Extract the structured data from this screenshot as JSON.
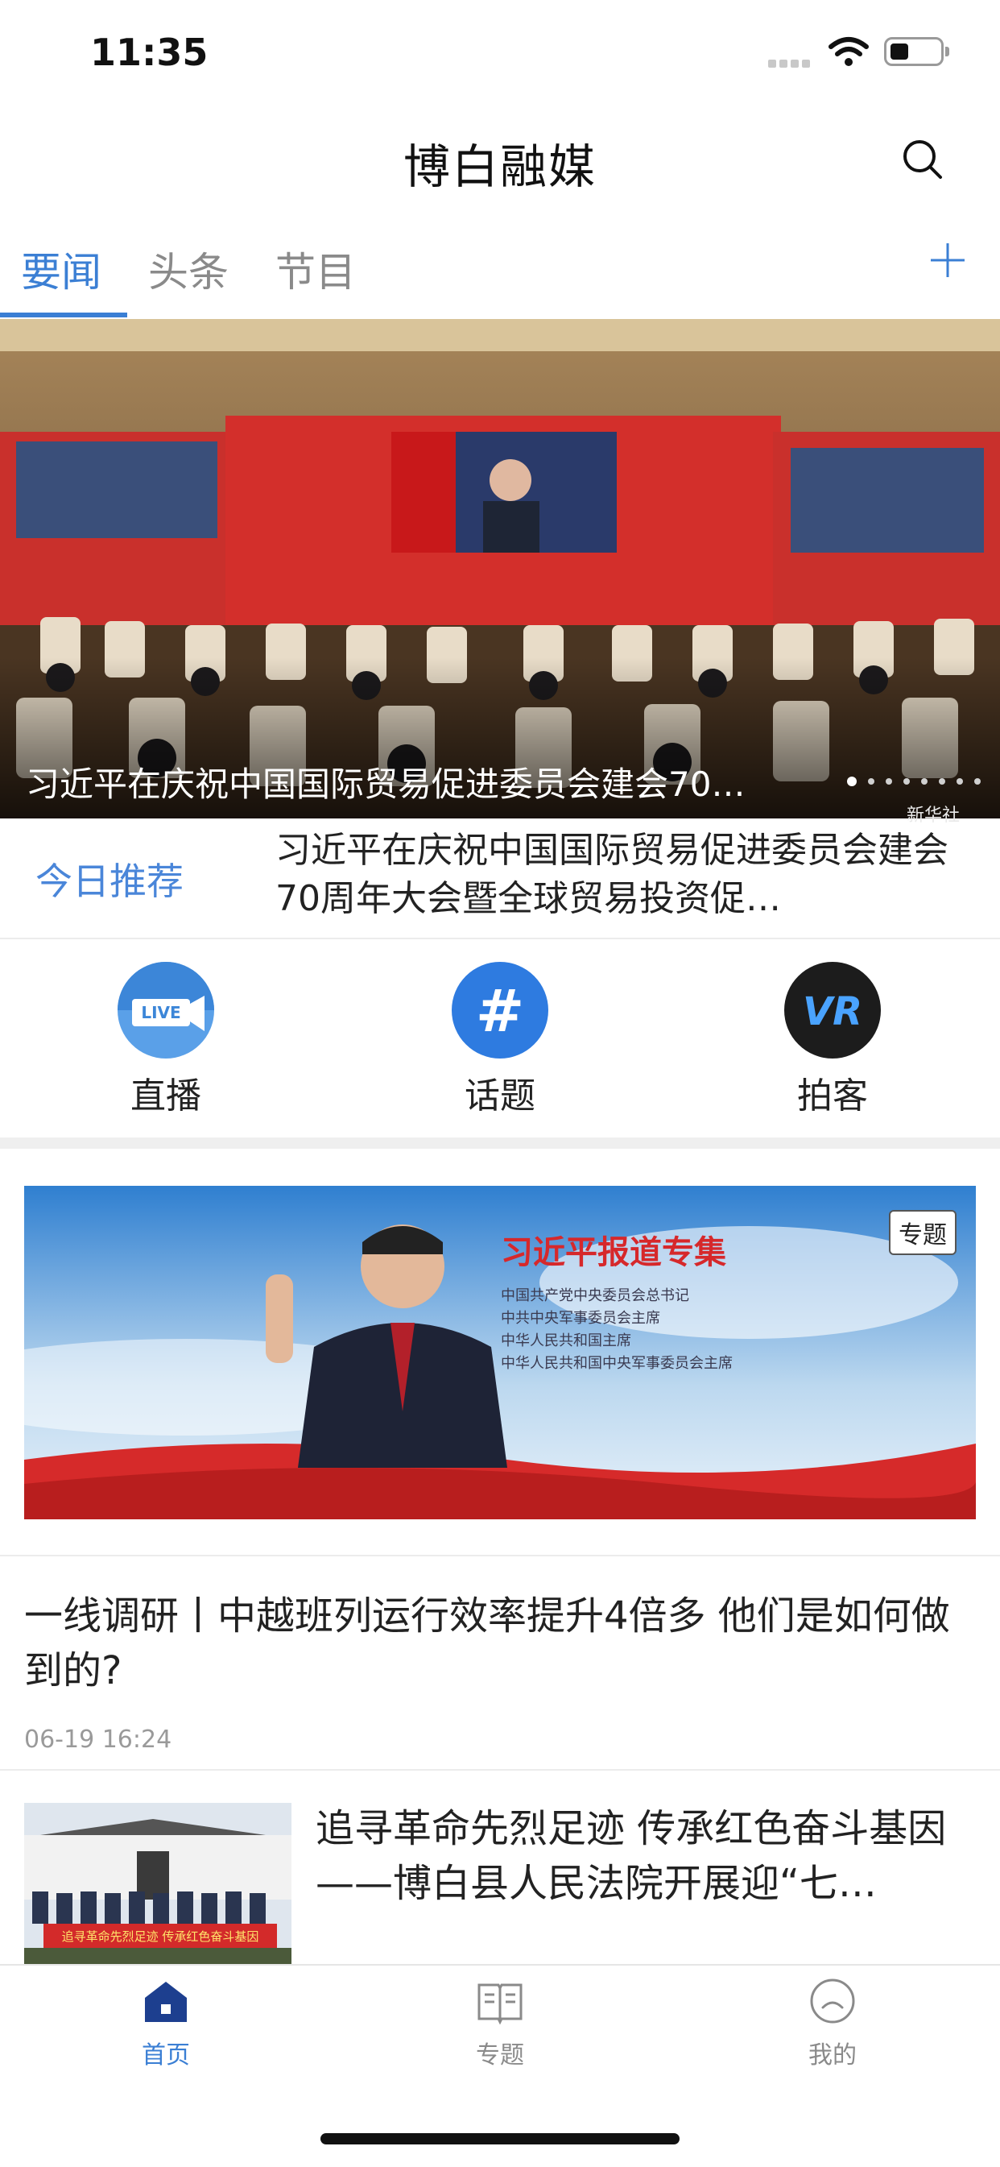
{
  "status_bar": {
    "time": "11:35"
  },
  "header": {
    "title": "博白融媒"
  },
  "tabs": [
    {
      "label": "要闻",
      "active": true
    },
    {
      "label": "头条",
      "active": false
    },
    {
      "label": "节目",
      "active": false
    }
  ],
  "hero": {
    "caption": "习近平在庆祝中国国际贸易促进委员会建会70…",
    "watermark": "新华社",
    "slide_count": 8,
    "active_slide": 1
  },
  "today_pick": {
    "label": "今日推荐",
    "text": "习近平在庆祝中国国际贸易促进委员会建会70周年大会暨全球贸易投资促…"
  },
  "quick_entries": [
    {
      "label": "直播",
      "icon": "live-icon",
      "badge": "LIVE"
    },
    {
      "label": "话题",
      "icon": "hashtag-icon",
      "badge": "#"
    },
    {
      "label": "拍客",
      "icon": "vr-icon",
      "badge": "VR"
    }
  ],
  "banner": {
    "title": "习近平报道专集",
    "lines": [
      "中国共产党中央委员会总书记",
      "中共中央军事委员会主席",
      "中华人民共和国主席",
      "中华人民共和国中央军事委员会主席"
    ],
    "badge": "专题"
  },
  "articles": [
    {
      "title": "一线调研丨中越班列运行效率提升4倍多 他们是如何做到的?",
      "time": "06-19 16:24"
    },
    {
      "title": "追寻革命先烈足迹 传承红色奋斗基因——博白县人民法院开展迎“七…",
      "thumb_text": "追寻革命先烈足迹 传承红色奋斗基因"
    }
  ],
  "bottom_nav": [
    {
      "label": "首页",
      "active": true
    },
    {
      "label": "专题",
      "active": false
    },
    {
      "label": "我的",
      "active": false
    }
  ],
  "colors": {
    "accent": "#3b7fd4",
    "banner_red": "#d6282b"
  }
}
